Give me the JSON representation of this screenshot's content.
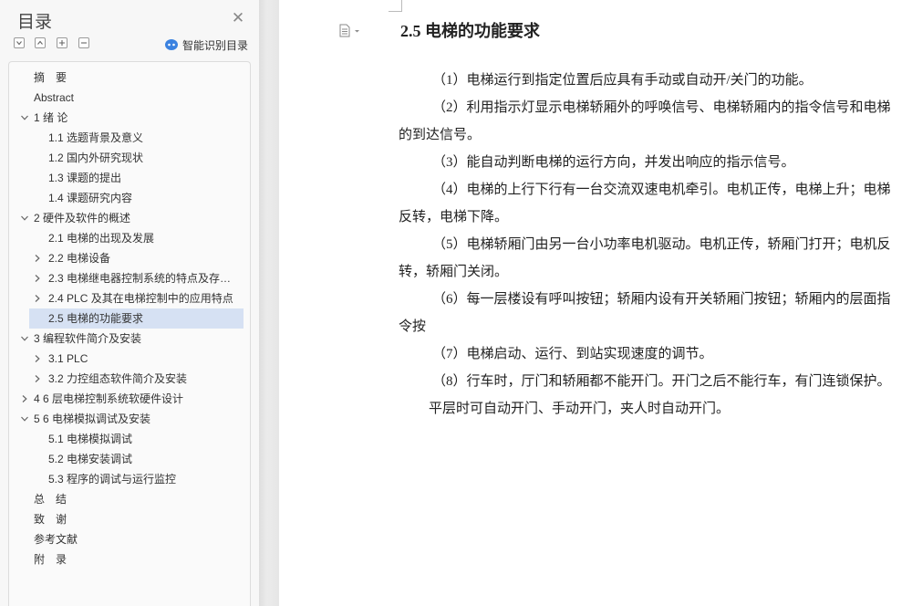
{
  "toc": {
    "title": "目录",
    "smart_label": "智能识别目录",
    "items": [
      {
        "label": "摘　要",
        "level": 1,
        "chevron": "none"
      },
      {
        "label": "Abstract",
        "level": 1,
        "chevron": "none"
      },
      {
        "label": "1 绪  论",
        "level": 1,
        "chevron": "down"
      },
      {
        "label": "1.1 选题背景及意义",
        "level": 2,
        "chevron": "none"
      },
      {
        "label": "1.2 国内外研究现状",
        "level": 2,
        "chevron": "none"
      },
      {
        "label": "1.3 课题的提出",
        "level": 2,
        "chevron": "none"
      },
      {
        "label": "1.4 课题研究内容",
        "level": 2,
        "chevron": "none"
      },
      {
        "label": "2 硬件及软件的概述",
        "level": 1,
        "chevron": "down"
      },
      {
        "label": "2.1 电梯的出现及发展",
        "level": 2,
        "chevron": "none"
      },
      {
        "label": "2.2 电梯设备",
        "level": 2,
        "chevron": "right"
      },
      {
        "label": "2.3 电梯继电器控制系统的特点及存在的问题",
        "level": 2,
        "chevron": "right"
      },
      {
        "label": "2.4 PLC 及其在电梯控制中的应用特点",
        "level": 2,
        "chevron": "right"
      },
      {
        "label": "2.5 电梯的功能要求",
        "level": 2,
        "chevron": "none",
        "selected": true
      },
      {
        "label": "3 编程软件简介及安装",
        "level": 1,
        "chevron": "down"
      },
      {
        "label": "3.1 PLC",
        "level": 2,
        "chevron": "right"
      },
      {
        "label": "3.2 力控组态软件简介及安装",
        "level": 2,
        "chevron": "right"
      },
      {
        "label": "4 6 层电梯控制系统软硬件设计",
        "level": 1,
        "chevron": "right"
      },
      {
        "label": "5 6 电梯模拟调试及安装",
        "level": 1,
        "chevron": "down"
      },
      {
        "label": "5.1 电梯模拟调试",
        "level": 2,
        "chevron": "none"
      },
      {
        "label": "5.2 电梯安装调试",
        "level": 2,
        "chevron": "none"
      },
      {
        "label": "5.3 程序的调试与运行监控",
        "level": 2,
        "chevron": "none"
      },
      {
        "label": "总　结",
        "level": 1,
        "chevron": "none"
      },
      {
        "label": "致　谢",
        "level": 1,
        "chevron": "none"
      },
      {
        "label": "参考文献",
        "level": 1,
        "chevron": "none"
      },
      {
        "label": "附　录",
        "level": 1,
        "chevron": "none"
      }
    ]
  },
  "doc": {
    "heading": "2.5 电梯的功能要求",
    "lines": [
      {
        "text": "（1）电梯运行到指定位置后应具有手动或自动开/关门的功能。",
        "indent": 1
      },
      {
        "text": "（2）利用指示灯显示电梯轿厢外的呼唤信号、电梯轿厢内的指令信号和电梯",
        "indent": 1
      },
      {
        "text": "的到达信号。",
        "indent": 0
      },
      {
        "text": "（3）能自动判断电梯的运行方向，并发出响应的指示信号。",
        "indent": 1
      },
      {
        "text": "（4）电梯的上行下行有一台交流双速电机牵引。电机正传，电梯上升；电梯",
        "indent": 1
      },
      {
        "text": "反转，电梯下降。",
        "indent": 0
      },
      {
        "text": "（5）电梯轿厢门由另一台小功率电机驱动。电机正传，轿厢门打开；电机反",
        "indent": 1
      },
      {
        "text": "转，轿厢门关闭。",
        "indent": 0
      },
      {
        "text": "（6）每一层楼设有呼叫按钮；轿厢内设有开关轿厢门按钮；轿厢内的层面指",
        "indent": 1
      },
      {
        "text": "令按",
        "indent": 0
      },
      {
        "text": "（7）电梯启动、运行、到站实现速度的调节。",
        "indent": 1
      },
      {
        "text": "（8）行车时，厅门和轿厢都不能开门。开门之后不能行车，有门连锁保护。",
        "indent": 1
      },
      {
        "text": "平层时可自动开门、手动开门，夹人时自动开门。",
        "indent": 2
      }
    ]
  },
  "colors": {
    "selected": "#d6e1f3",
    "accent": "#3b82e0"
  }
}
